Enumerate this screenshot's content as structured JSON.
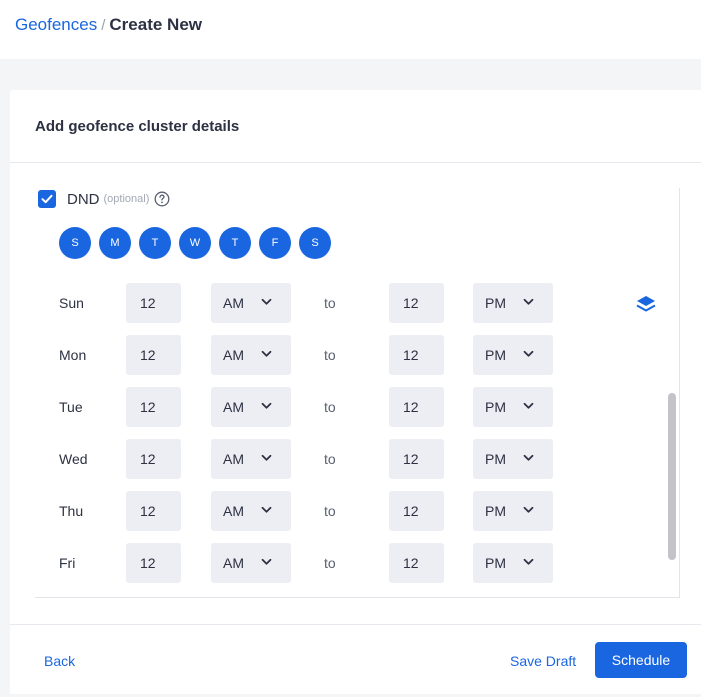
{
  "breadcrumb": {
    "parent": "Geofences",
    "separator": "/",
    "current": "Create New"
  },
  "card": {
    "title": "Add geofence cluster details"
  },
  "dnd": {
    "label": "DND",
    "optional": "(optional)",
    "checked": true
  },
  "weekdays": [
    "S",
    "M",
    "T",
    "W",
    "T",
    "F",
    "S"
  ],
  "schedule": {
    "to_label": "to",
    "rows": [
      {
        "day": "Sun",
        "from_hour": "12",
        "from_period": "AM",
        "to_hour": "12",
        "to_period": "PM"
      },
      {
        "day": "Mon",
        "from_hour": "12",
        "from_period": "AM",
        "to_hour": "12",
        "to_period": "PM"
      },
      {
        "day": "Tue",
        "from_hour": "12",
        "from_period": "AM",
        "to_hour": "12",
        "to_period": "PM"
      },
      {
        "day": "Wed",
        "from_hour": "12",
        "from_period": "AM",
        "to_hour": "12",
        "to_period": "PM"
      },
      {
        "day": "Thu",
        "from_hour": "12",
        "from_period": "AM",
        "to_hour": "12",
        "to_period": "PM"
      },
      {
        "day": "Fri",
        "from_hour": "12",
        "from_period": "AM",
        "to_hour": "12",
        "to_period": "PM"
      }
    ]
  },
  "footer": {
    "back": "Back",
    "save_draft": "Save Draft",
    "schedule": "Schedule"
  },
  "icons": {
    "checkbox": "check-icon",
    "help": "question-circle-icon",
    "layers": "layers-icon",
    "dropdown": "chevron-down-icon"
  },
  "colors": {
    "accent": "#1a66e0",
    "input_bg": "#eceef3",
    "page_bg": "#f4f5f7"
  }
}
